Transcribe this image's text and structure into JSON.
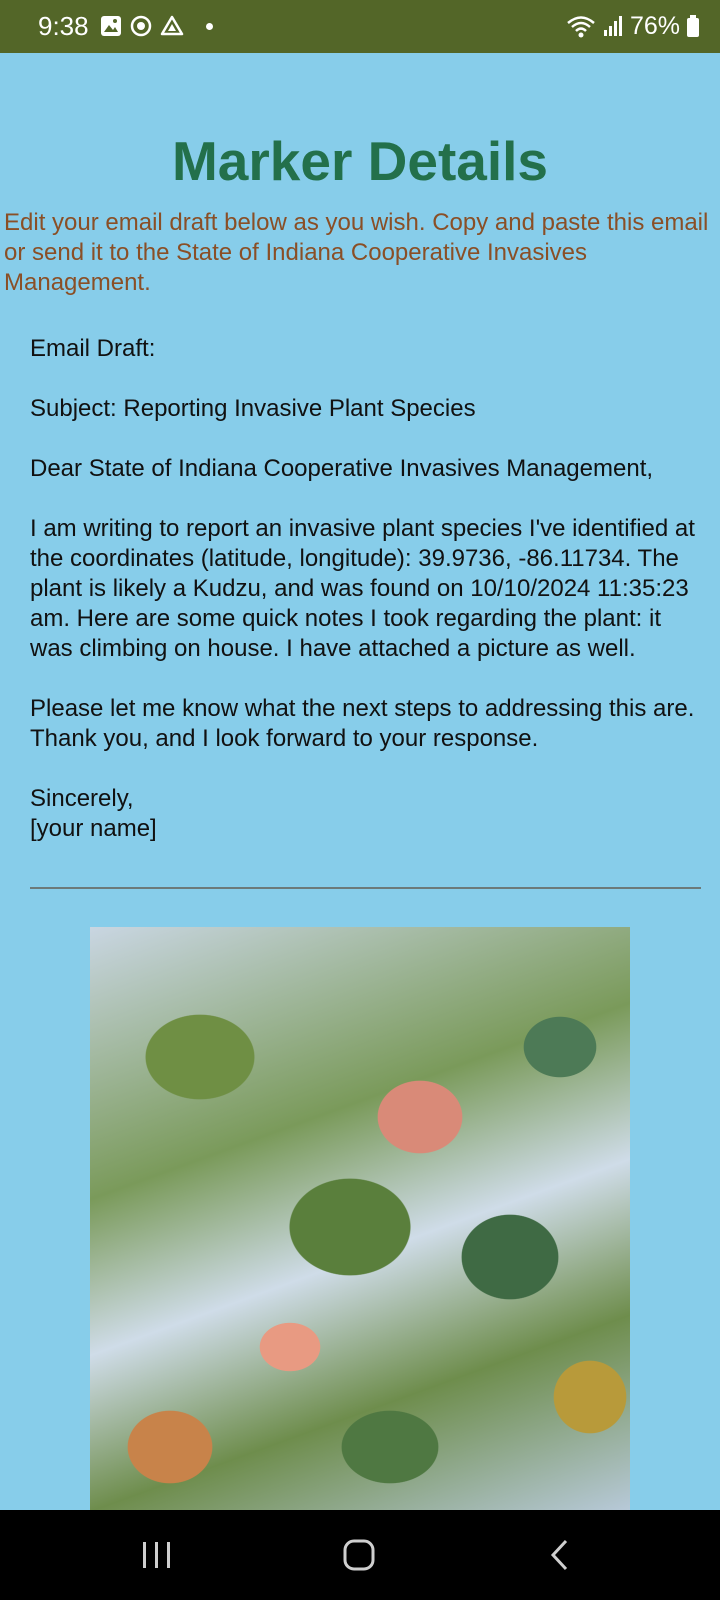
{
  "status_bar": {
    "time": "9:38",
    "battery": "76%",
    "icons_left": [
      "image-icon",
      "sync-icon",
      "drive-icon",
      "dot-icon"
    ],
    "icons_right": [
      "wifi-icon",
      "signal-icon",
      "battery-icon"
    ]
  },
  "page": {
    "title": "Marker Details",
    "instructions": "Edit your email draft below as you wish. Copy and paste this email or send it to the State of Indiana Cooperative Invasives Management."
  },
  "email": {
    "label": "Email Draft:",
    "subject": "Subject: Reporting Invasive Plant Species",
    "greeting": "Dear State of Indiana Cooperative Invasives Management,",
    "body": "I am writing to report an invasive plant species I've identified at the coordinates (latitude, longitude): 39.9736, -86.11734. The plant is likely a Kudzu, and was found on 10/10/2024 11:35:23 am. Here are some quick notes I took regarding the plant: it was climbing on house. I have attached a picture as well.",
    "closing": "Please let me know what the next steps to addressing this are. Thank you, and I look forward to your response.",
    "signoff": "Sincerely,",
    "signature": "[your name]"
  },
  "nav_bar": {
    "buttons": [
      "recent-apps-icon",
      "home-icon",
      "back-icon"
    ]
  },
  "colors": {
    "background": "#87cdea",
    "status_bar": "#536628",
    "title": "#23704b",
    "instructions": "#8a4f26"
  }
}
